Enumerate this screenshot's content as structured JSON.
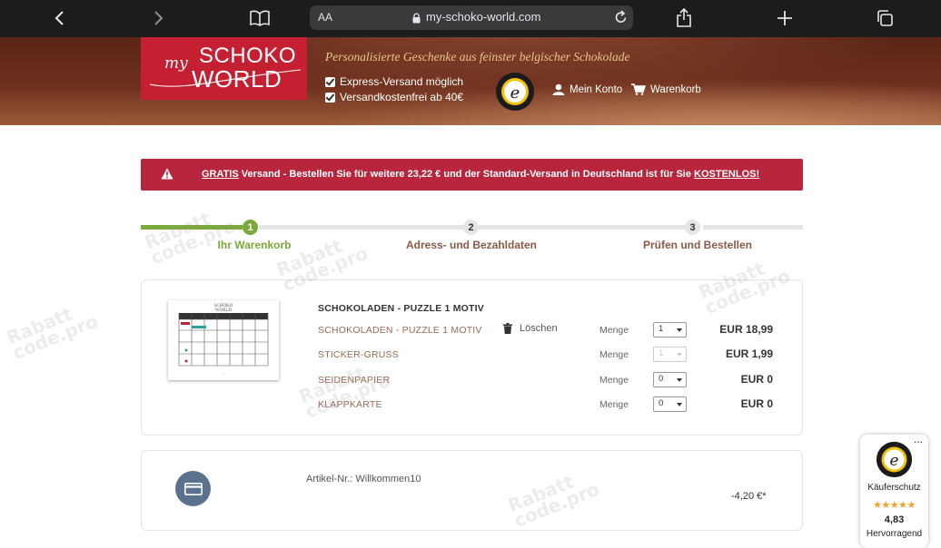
{
  "browser": {
    "aa_label": "AA",
    "url": "my-schoko-world.com"
  },
  "header": {
    "logo_my": "my",
    "logo_line1": "SCHOKO",
    "logo_line2": "WORLD",
    "tagline": "Personalisierte Geschenke aus feinster belgischer Schokolade",
    "checks": [
      "Express-Versand möglich",
      "Versandkostenfrei ab 40€"
    ],
    "account_label": "Mein Konto",
    "cart_label": "Warenkorb"
  },
  "banner": {
    "part1": "GRATIS",
    "part2": " Versand - Bestellen Sie für weitere 23,22 € und der Standard-Versand in Deutschland ist für Sie ",
    "part3": "KOSTENLOS!"
  },
  "steps": [
    {
      "num": "1",
      "label": "Ihr Warenkorb",
      "active": true
    },
    {
      "num": "2",
      "label": "Adress- und Bezahldaten",
      "active": false
    },
    {
      "num": "3",
      "label": "Prüfen und Bestellen",
      "active": false
    }
  ],
  "cart": {
    "product_title": "SCHOKOLADEN - PUZZLE 1 MOTIV",
    "delete_label": "Löschen",
    "qty_label": "Menge",
    "rows": [
      {
        "label": "SCHOKOLADEN - PUZZLE 1 MOTIV",
        "qty": "1",
        "price": "EUR 18,99",
        "disabled": false
      },
      {
        "label": "STICKER-GRUSS",
        "qty": "1",
        "price": "EUR 1,99",
        "disabled": true
      },
      {
        "label": "SEIDENPAPIER",
        "qty": "0",
        "price": "EUR 0",
        "disabled": false
      },
      {
        "label": "KLAPPKARTE",
        "qty": "0",
        "price": "EUR 0",
        "disabled": false
      }
    ]
  },
  "coupon": {
    "article_no": "Artikel-Nr.: Willkommen10",
    "discount": "-4,20 €*"
  },
  "trusted_widget": {
    "dots": "...",
    "label": "Käuferschutz",
    "stars": "★★★★★",
    "rating": "4,83",
    "rating_word": "Hervorragend"
  },
  "colors": {
    "brand_red": "#c42032",
    "banner_red": "#b7263c",
    "step_active": "#7ba93a",
    "step_label": "#8b5a45"
  }
}
